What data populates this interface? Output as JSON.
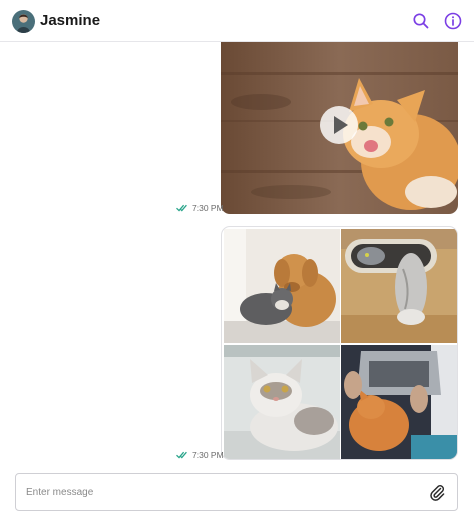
{
  "header": {
    "contact_name": "Jasmine",
    "avatar_icon": "avatar-photo",
    "search_icon": "search-icon",
    "info_icon": "info-icon",
    "accent_color": "#7b3fe4"
  },
  "thread": {
    "messages": [
      {
        "type": "video",
        "time": "7:30 PM",
        "status": "delivered",
        "thumbnail": "orange-cat-on-wood-floor",
        "play_icon": "play-icon"
      },
      {
        "type": "photo-grid",
        "time": "7:30 PM",
        "status": "delivered",
        "photos": [
          "dog-and-cat-cuddling",
          "cat-in-round-hole",
          "fluffy-white-cat",
          "cat-on-laptop"
        ]
      }
    ],
    "tick_color": "#2aa58b"
  },
  "composer": {
    "placeholder": "Enter message",
    "value": "",
    "attach_icon": "paperclip-icon"
  }
}
